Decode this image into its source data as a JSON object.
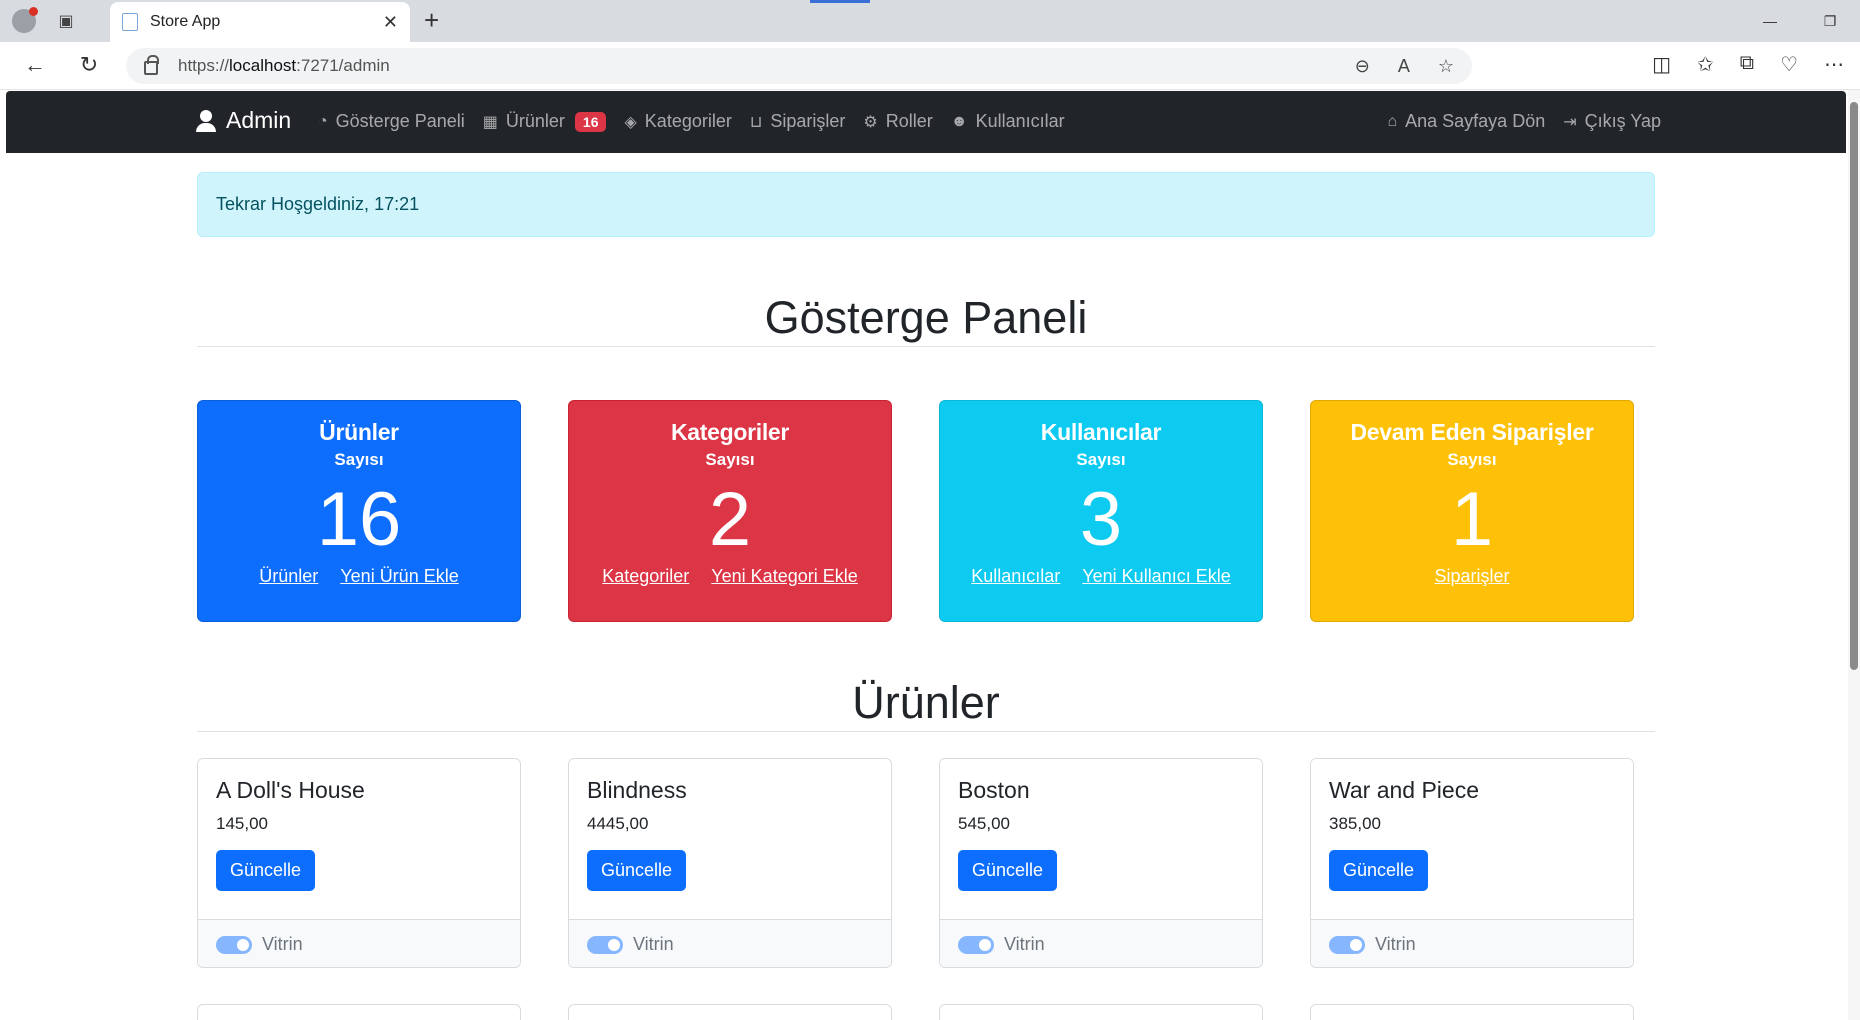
{
  "browser": {
    "tab_title": "Store App",
    "url_prefix": "https://",
    "url_host": "localhost",
    "url_rest": ":7271/admin"
  },
  "navbar": {
    "brand": "Admin",
    "links": [
      {
        "label": "Gösterge Paneli",
        "icon": "dashboard-icon"
      },
      {
        "label": "Ürünler",
        "icon": "boxes-icon",
        "badge": "16"
      },
      {
        "label": "Kategoriler",
        "icon": "tags-icon"
      },
      {
        "label": "Siparişler",
        "icon": "basket-icon"
      },
      {
        "label": "Roller",
        "icon": "users-gear-icon"
      },
      {
        "label": "Kullanıcılar",
        "icon": "users-icon"
      }
    ],
    "right_links": [
      {
        "label": "Ana Sayfaya Dön",
        "icon": "home-icon"
      },
      {
        "label": "Çıkış Yap",
        "icon": "logout-icon"
      }
    ]
  },
  "alert": {
    "text": "Tekrar Hoşgeldiniz, 17:21"
  },
  "dashboard": {
    "title": "Gösterge Paneli",
    "cards": [
      {
        "title": "Ürünler",
        "subtitle": "Sayısı",
        "count": "16",
        "links": [
          "Ürünler",
          "Yeni Ürün Ekle"
        ],
        "color": "#0d6efd"
      },
      {
        "title": "Kategoriler",
        "subtitle": "Sayısı",
        "count": "2",
        "links": [
          "Kategoriler",
          "Yeni Kategori Ekle"
        ],
        "color": "#dc3545"
      },
      {
        "title": "Kullanıcılar",
        "subtitle": "Sayısı",
        "count": "3",
        "links": [
          "Kullanıcılar",
          "Yeni Kullanıcı Ekle"
        ],
        "color": "#0dcaf0"
      },
      {
        "title": "Devam Eden Siparişler",
        "subtitle": "Sayısı",
        "count": "1",
        "links": [
          "Siparişler"
        ],
        "color": "#ffc107"
      }
    ]
  },
  "products": {
    "title": "Ürünler",
    "items": [
      {
        "name": "A Doll's House",
        "price": "145,00",
        "button": "Güncelle",
        "toggle_label": "Vitrin"
      },
      {
        "name": "Blindness",
        "price": "4445,00",
        "button": "Güncelle",
        "toggle_label": "Vitrin"
      },
      {
        "name": "Boston",
        "price": "545,00",
        "button": "Güncelle",
        "toggle_label": "Vitrin"
      },
      {
        "name": "War and Piece",
        "price": "385,00",
        "button": "Güncelle",
        "toggle_label": "Vitrin"
      }
    ]
  }
}
